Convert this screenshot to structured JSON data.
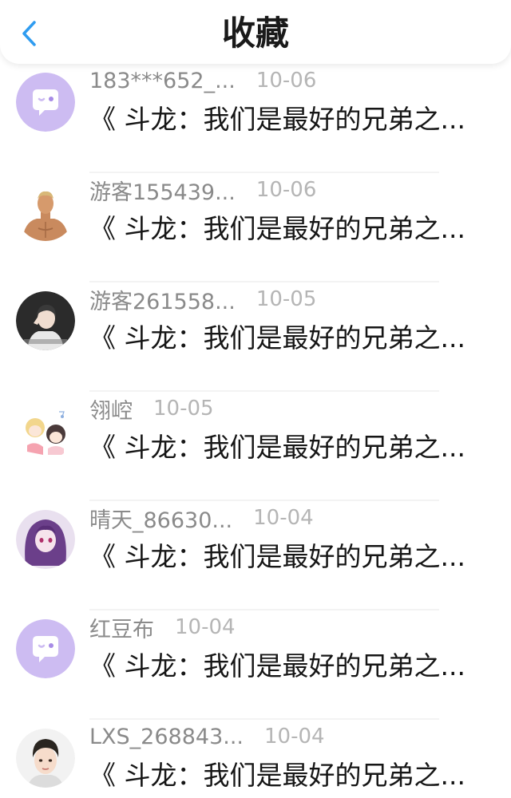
{
  "header": {
    "title": "收藏",
    "back_icon": "chevron-left-icon",
    "accent_color": "#2f9cf0"
  },
  "items": [
    {
      "username": "183***652_...",
      "date": "10-06",
      "text": "《 斗龙：我们是最好的兄弟之...",
      "avatar": "purple-chat-default"
    },
    {
      "username": "游客155439...",
      "date": "10-06",
      "text": "《 斗龙：我们是最好的兄弟之...",
      "avatar": "muscular-man-photo"
    },
    {
      "username": "游客261558...",
      "date": "10-05",
      "text": "《 斗龙：我们是最好的兄弟之...",
      "avatar": "dark-portrait-photo"
    },
    {
      "username": "翎崆",
      "date": "10-05",
      "text": "《 斗龙：我们是最好的兄弟之...",
      "avatar": "anime-chibi-drawing"
    },
    {
      "username": "晴天_86630...",
      "date": "10-04",
      "text": "《 斗龙：我们是最好的兄弟之...",
      "avatar": "anime-purple-hair-girl"
    },
    {
      "username": "红豆布",
      "date": "10-04",
      "text": "《 斗龙：我们是最好的兄弟之...",
      "avatar": "purple-chat-default"
    },
    {
      "username": "LXS_268843...",
      "date": "10-04",
      "text": "《 斗龙：我们是最好的兄弟之...",
      "avatar": "young-man-photo"
    }
  ]
}
